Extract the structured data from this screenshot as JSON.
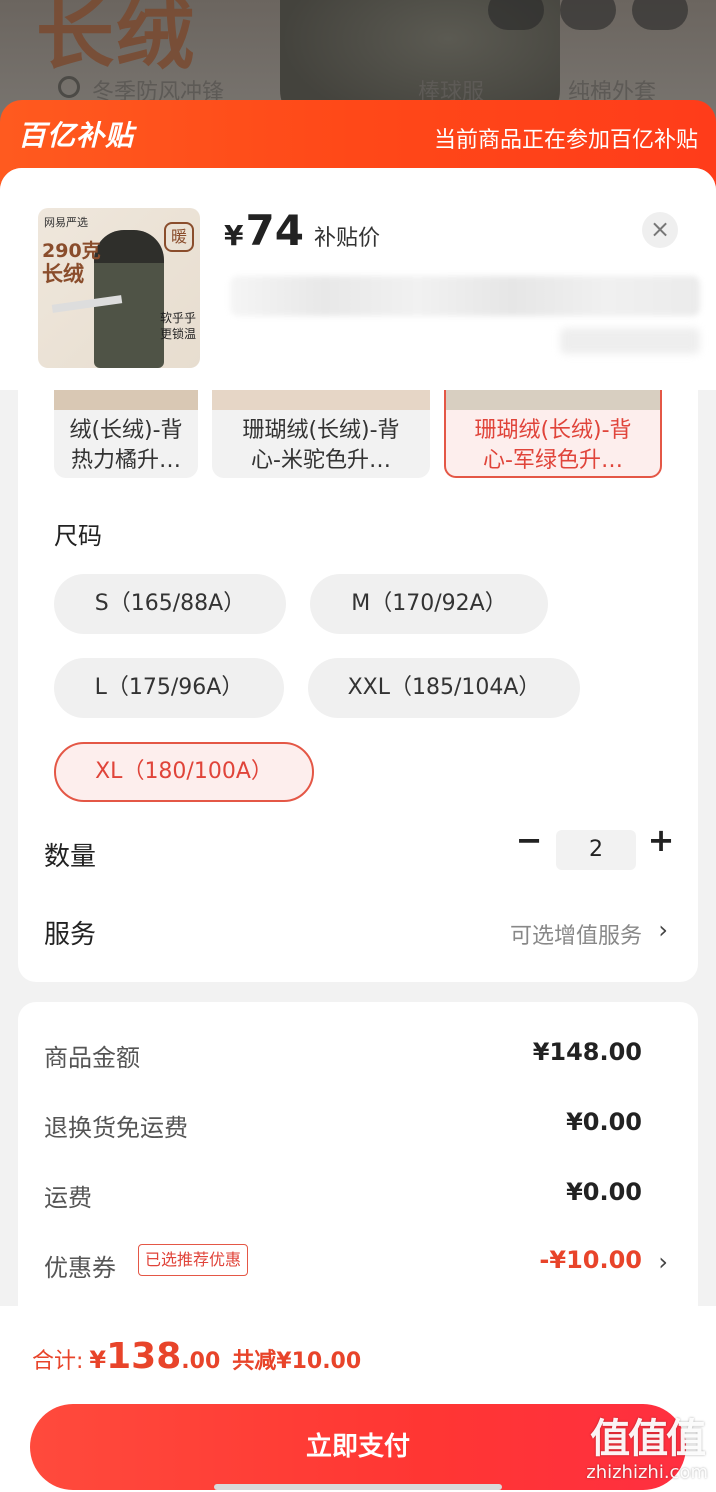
{
  "background": {
    "hero_text": "长绒",
    "search_items": [
      "冬季防风冲锋",
      "棒球服",
      "纯棉外套"
    ]
  },
  "subsidy_banner": {
    "logo": "百亿补贴",
    "note": "当前商品正在参加百亿补贴"
  },
  "product": {
    "thumb_brand": "网易严选",
    "thumb_weight": "290克",
    "thumb_title": "长绒",
    "thumb_warm_badge": "暖",
    "thumb_note_line1": "软乎乎",
    "thumb_note_line2": "更锁温",
    "price_currency": "¥",
    "price_value": "74",
    "price_label": "补贴价",
    "close_icon": "close-icon"
  },
  "color_variants": [
    {
      "label": "绒(长绒)-背\n热力橘升…",
      "selected": false
    },
    {
      "label": "珊瑚绒(长绒)-背\n心-米驼色升…",
      "selected": false
    },
    {
      "label": "珊瑚绒(长绒)-背\n心-军绿色升…",
      "selected": true
    }
  ],
  "size_section": {
    "title": "尺码",
    "sizes": [
      {
        "label": "S（165/88A）",
        "selected": false
      },
      {
        "label": "M（170/92A）",
        "selected": false
      },
      {
        "label": "L（175/96A）",
        "selected": false
      },
      {
        "label": "XXL（185/104A）",
        "selected": false
      },
      {
        "label": "XL（180/100A）",
        "selected": true
      }
    ]
  },
  "quantity": {
    "label": "数量",
    "minus": "−",
    "value": "2",
    "plus": "+"
  },
  "service": {
    "label": "服务",
    "link": "可选增值服务",
    "chevron": "›"
  },
  "price_detail": {
    "lines": [
      {
        "label": "商品金额",
        "value": "¥148.00"
      },
      {
        "label": "退换货免运费",
        "value": "¥0.00"
      },
      {
        "label": "运费",
        "value": "¥0.00"
      }
    ],
    "coupon_label": "优惠券",
    "coupon_tag": "已选推荐优惠",
    "coupon_value": "-¥10.00",
    "coupon_chevron": "›"
  },
  "bottom": {
    "total_label": "合计:",
    "total_currency": "¥",
    "total_int": "138",
    "total_dec": ".00",
    "total_save": "共减¥10.00",
    "pay_label": "立即支付"
  },
  "watermark": {
    "mark": "值值值",
    "url": "zhizhizhi.com"
  },
  "colors": {
    "accent": "#e8442a",
    "banner": "#ff4818",
    "selected_bg": "#fdeeed"
  }
}
